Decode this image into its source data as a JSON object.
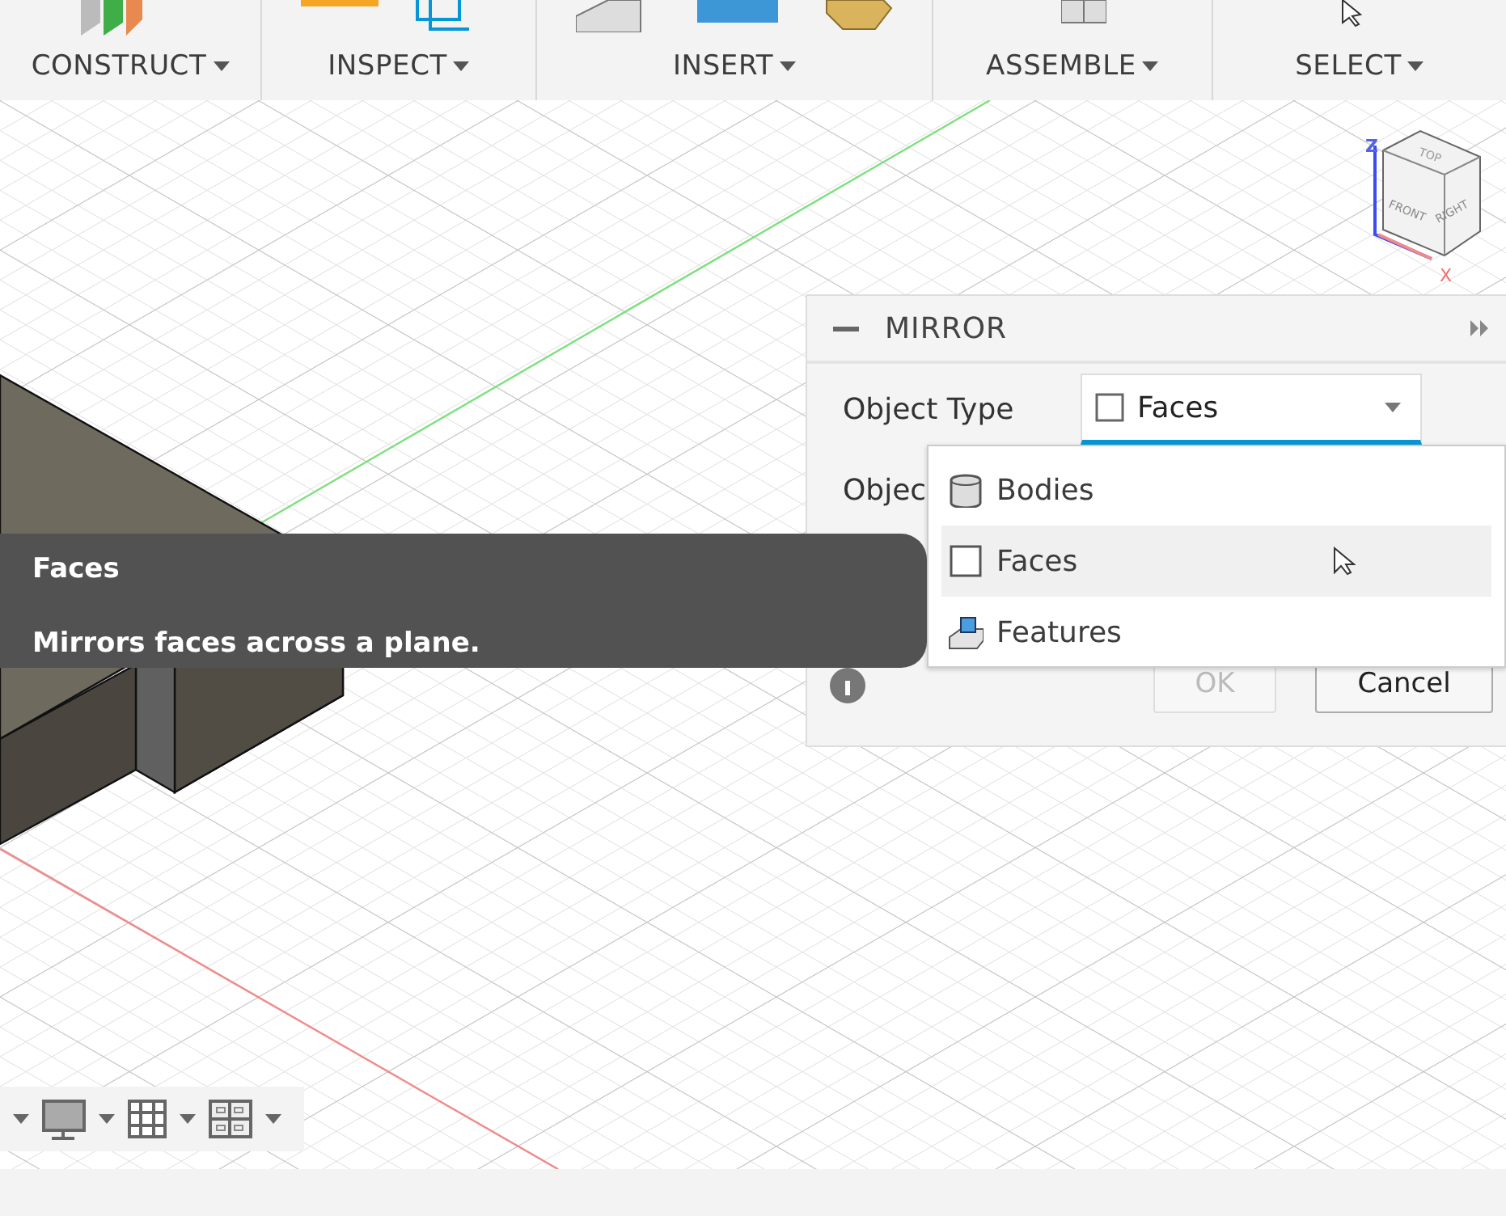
{
  "toolbar": {
    "groups": [
      {
        "label": "CONSTRUCT",
        "kind": "construct"
      },
      {
        "label": "INSPECT",
        "kind": "inspect"
      },
      {
        "label": "INSERT",
        "kind": "insert"
      },
      {
        "label": "ASSEMBLE",
        "kind": "assemble"
      },
      {
        "label": "SELECT",
        "kind": "select"
      }
    ]
  },
  "viewcube": {
    "top": "TOP",
    "front": "FRONT",
    "right": "RIGHT",
    "z_axis": "Z",
    "x_axis": "X"
  },
  "dialog": {
    "title": "MIRROR",
    "object_type": {
      "label": "Object Type",
      "value": "Faces"
    },
    "row_2_label": "Objec",
    "buttons": [
      {
        "label": "OK",
        "disabled": true
      },
      {
        "label": "Cancel",
        "disabled": false
      }
    ]
  },
  "dropdown": {
    "options": [
      {
        "label": "Bodies",
        "kind": "body",
        "selected": false
      },
      {
        "label": "Faces",
        "kind": "face",
        "selected": true
      },
      {
        "label": "Features",
        "kind": "feature",
        "selected": false
      }
    ]
  },
  "tooltip": {
    "title": "Faces",
    "text": "Mirrors faces across a plane."
  },
  "nav_bar": {
    "items": [
      {
        "kind": "caret"
      },
      {
        "kind": "display"
      },
      {
        "kind": "grid"
      },
      {
        "kind": "viewports"
      }
    ]
  }
}
